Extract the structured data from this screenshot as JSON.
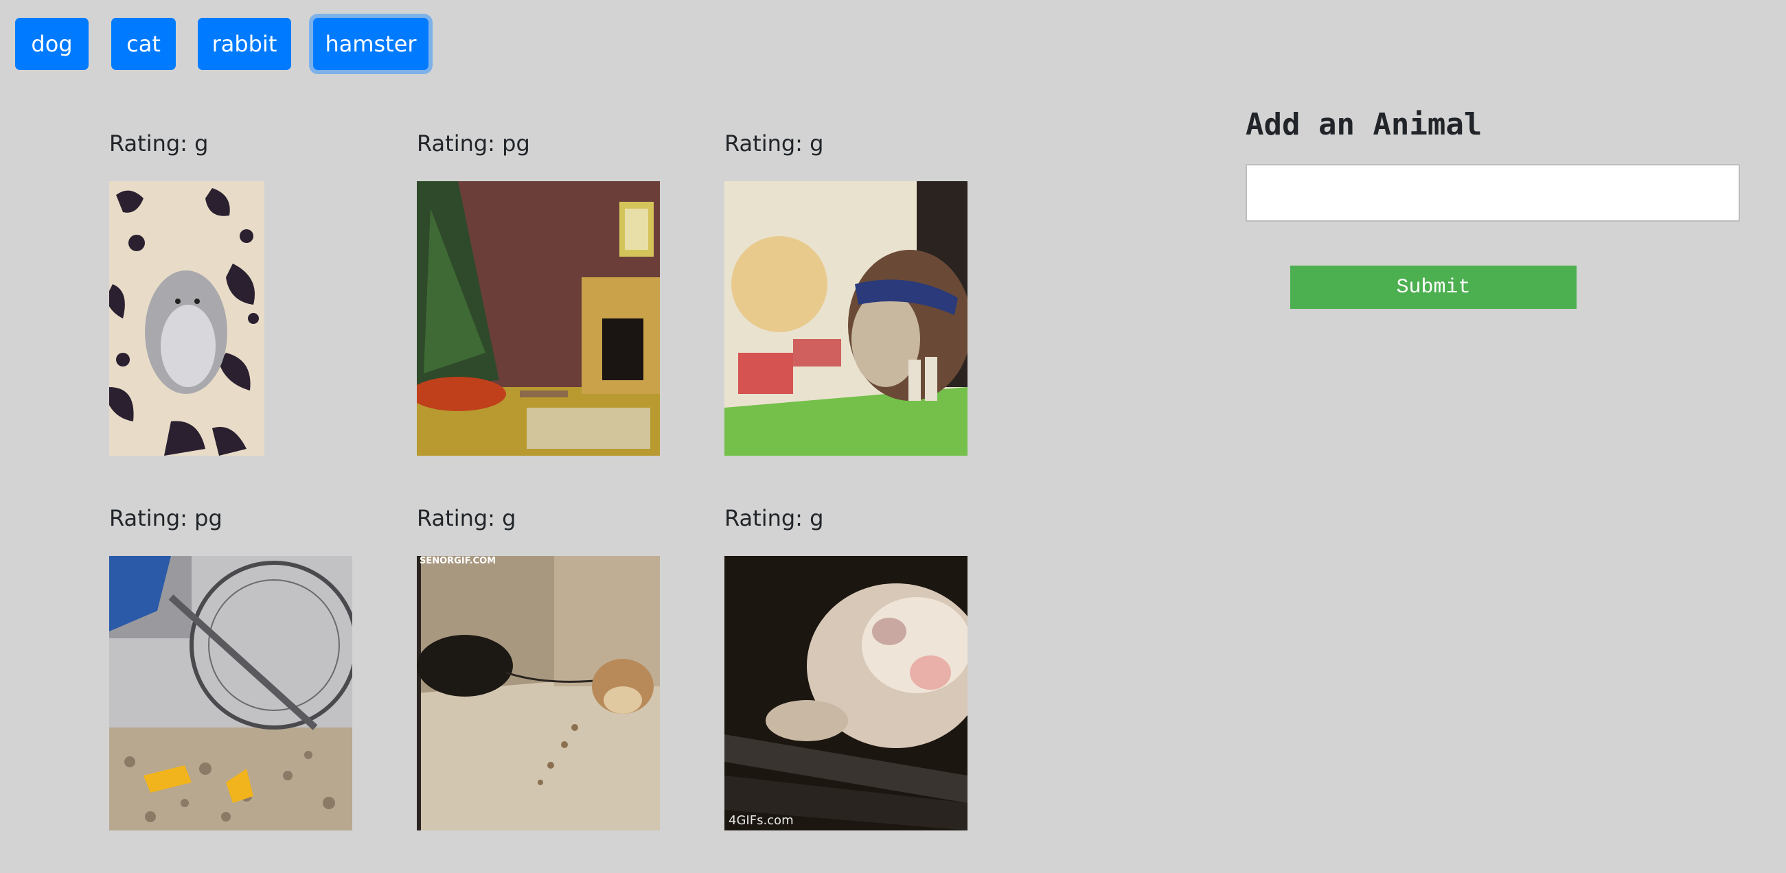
{
  "nav": {
    "buttons": [
      {
        "label": "dog"
      },
      {
        "label": "cat"
      },
      {
        "label": "rabbit"
      },
      {
        "label": "hamster"
      }
    ],
    "active": "hamster"
  },
  "gifs": [
    {
      "rating": "Rating: g"
    },
    {
      "rating": "Rating: pg"
    },
    {
      "rating": "Rating: g"
    },
    {
      "rating": "Rating: pg"
    },
    {
      "rating": "Rating: g"
    },
    {
      "rating": "Rating: g"
    }
  ],
  "gif_overlays": {
    "watermark_1": "SENORGIF.COM",
    "watermark_2": "4GIFs.com"
  },
  "form": {
    "title": "Add an Animal",
    "input_value": "",
    "submit_label": "Submit"
  },
  "colors": {
    "background": "#d3d3d3",
    "primary_button": "#007bff",
    "submit_button": "#4caf50"
  }
}
